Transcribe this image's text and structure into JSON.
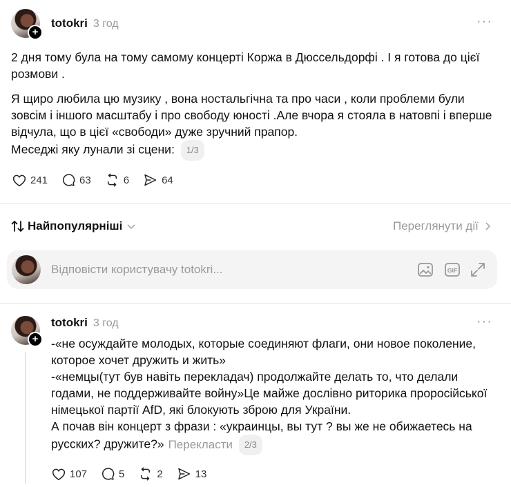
{
  "post": {
    "username": "totokri",
    "time": "3 год",
    "paragraph1": "2 дня тому була на тому самому концерті Коржа в Дюссельдорфі . І я готова до цієї розмови .",
    "paragraph2": "Я щиро любила цю музику , вона ностальгічна та про часи , коли проблеми були зовсім і іншого масштабу і про свободу юності .Але вчора я стояла в натовпі і вперше відчула, що в цієї «свободи» дуже зручний прапор.",
    "paragraph3": "Меседжі яку лунали зі сцени:",
    "pager": "1/3",
    "likes": "241",
    "comments": "63",
    "reposts": "6",
    "shares": "64"
  },
  "sort": {
    "label": "Найпопулярніші",
    "view_activity": "Переглянути дії"
  },
  "reply": {
    "placeholder": "Відповісти користувачу totokri..."
  },
  "comment": {
    "username": "totokri",
    "time": "3 год",
    "line1": "-«не осуждайте молодых, которые соединяют флаги, они новое поколение, которое хочет дружить и жить»",
    "line2": "-«немцы(тут був навіть перекладач) продолжайте делать то, что делали годами, не поддерживайте войну»Це майже дослівно риторика проросійської німецької партії AfD, які блокують зброю для України.",
    "line3": "А почав він концерт з фрази : «украинцы, вы тут ? вы же не обижаетесь на русских? дружите?»",
    "translate": "Перекласти",
    "pager": "2/3",
    "likes": "107",
    "comments": "5",
    "reposts": "2",
    "shares": "13"
  },
  "icons": {
    "more": "more-horizontal-icon",
    "heart": "heart-icon",
    "comment": "comment-icon",
    "repost": "repost-icon",
    "share": "send-icon",
    "sort": "sort-arrows-icon",
    "image": "image-icon",
    "gif": "gif-icon",
    "expand": "expand-icon"
  }
}
